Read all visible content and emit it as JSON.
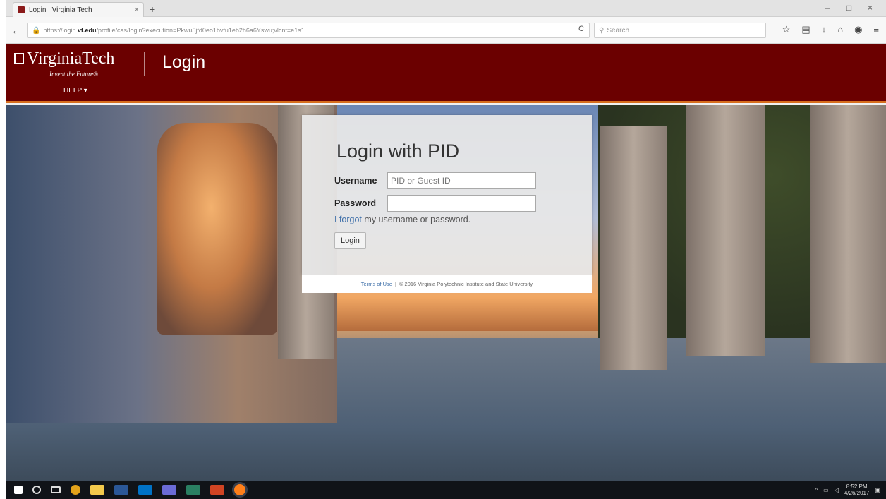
{
  "browser": {
    "tab_title": "Login | Virginia Tech",
    "tab_close": "×",
    "new_tab": "+",
    "url_prefix": "https://login.",
    "url_host": "vt.edu",
    "url_rest": "/profile/cas/login?execution=Pkwu5jfd0eo1bvfu1eb2h6a6Yswu;vlcnt=e1s1",
    "search_placeholder": "Search",
    "back": "←",
    "reload": "C",
    "win_min": "–",
    "win_max": "□",
    "win_close": "×"
  },
  "header": {
    "logo": "VirginiaTech",
    "tagline": "Invent the Future®",
    "page_title": "Login",
    "help": "HELP ▾"
  },
  "login": {
    "title": "Login with PID",
    "username_label": "Username",
    "username_placeholder": "PID or Guest ID",
    "username_value": "",
    "password_label": "Password",
    "password_value": "",
    "forgot_link": "I forgot",
    "forgot_rest": "my username or password.",
    "button": "Login"
  },
  "footer": {
    "terms": "Terms of Use",
    "separator": "|",
    "copyright": "© 2016 Virginia Polytechnic Institute and State University"
  },
  "taskbar": {
    "time": "8:52 PM",
    "date": "4/26/2017"
  },
  "colors": {
    "vt_maroon": "#6b0000",
    "vt_orange": "#d66e1e"
  }
}
